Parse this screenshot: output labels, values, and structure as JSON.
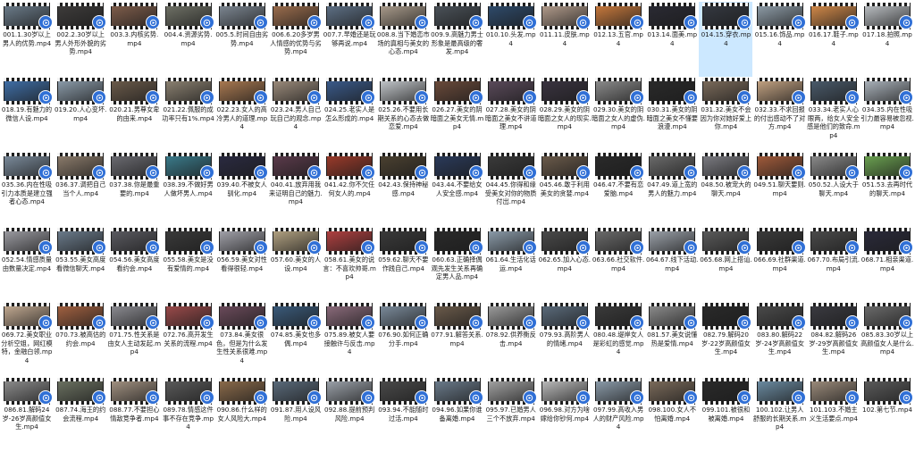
{
  "accent_color": "#2f6fd6",
  "selected_index": 13,
  "file_icon": "video-file-icon",
  "files": [
    {
      "name": "001.1.30岁以上男人的优势.mp4",
      "tint": "#6a7a88"
    },
    {
      "name": "002.2.30岁以上男人外形外貌的劣势.mp4",
      "tint": "#3d3b3a"
    },
    {
      "name": "003.3.内核劣势.mp4",
      "tint": "#7d5c4a"
    },
    {
      "name": "004.4.资源劣势.mp4",
      "tint": "#6e7065"
    },
    {
      "name": "005.5.时间自由劣势.mp4",
      "tint": "#7b8590"
    },
    {
      "name": "006.6.20多岁男人情感的优势与劣势.mp4",
      "tint": "#9a6c4c"
    },
    {
      "name": "007.7.早婚还是玩够再说.mp4",
      "tint": "#5d6f84"
    },
    {
      "name": "008.8.当下婚恋市场的真相与美女的心态.mp4",
      "tint": "#a89a8a"
    },
    {
      "name": "009.9.高魅力男士形象是最高级的奢发.mp4",
      "tint": "#4a5158"
    },
    {
      "name": "010.10.头发.mp4",
      "tint": "#2e4a6a"
    },
    {
      "name": "011.11.皮肤.mp4",
      "tint": "#b09a8a"
    },
    {
      "name": "012.13.五官.mp4",
      "tint": "#c6783c"
    },
    {
      "name": "013.14.面美.mp4",
      "tint": "#2a2a33"
    },
    {
      "name": "014.15.穿衣.mp4",
      "tint": "#343840"
    },
    {
      "name": "015.16.饰品.mp4",
      "tint": "#8c9aa5"
    },
    {
      "name": "016.17.鞋子.mp4",
      "tint": "#d08848"
    },
    {
      "name": "017.18.拍照.mp4",
      "tint": "#b8bcc0"
    },
    {
      "name": "018.19.有魅力的微信人设.mp4",
      "tint": "#3f6ea6"
    },
    {
      "name": "019.20.人心变坏.mp4",
      "tint": "#8a9aa8"
    },
    {
      "name": "020.21.男尊女卑的由来.mp4",
      "tint": "#6a5a4a"
    },
    {
      "name": "021.22.佩服的成功率只有1%.mp4",
      "tint": "#8a8070"
    },
    {
      "name": "022.23.女人的高冷男人的道理.mp4",
      "tint": "#a87850"
    },
    {
      "name": "023.24.男人自己玩自己的观念.mp4",
      "tint": "#9a8a7a"
    },
    {
      "name": "024.25.老实人是怎么形成的.mp4",
      "tint": "#3a5a8a"
    },
    {
      "name": "025.26.不要用长期关系的心态去做恋爱.mp4",
      "tint": "#c0c4c8"
    },
    {
      "name": "026.27.美女的阴暗面之美女无情.mp4",
      "tint": "#6a4a3a"
    },
    {
      "name": "027.28.美女的阴暗面之美女不讲道理.mp4",
      "tint": "#5a4a5a"
    },
    {
      "name": "028.29.美女的阴暗面之女人的现实.mp4",
      "tint": "#3a3440"
    },
    {
      "name": "029.30.美女的阴暗面之女人的虚伪.mp4",
      "tint": "#8a8a8a"
    },
    {
      "name": "030.31.美女的阴暗面之美女不懂要浪漫.mp4",
      "tint": "#2a2a2a"
    },
    {
      "name": "031.32.美女不会因为你对她好爱上你.mp4",
      "tint": "#7a6a5a"
    },
    {
      "name": "032.33.不求回报的付出感动不了对方.mp4",
      "tint": "#c0a080"
    },
    {
      "name": "033.34.老实人心眼两，给女人安全感是他们的致命.mp4",
      "tint": "#4a5a6a"
    },
    {
      "name": "034.35.内在性吸引力最容易被忽视.mp4",
      "tint": "#a8b0b8"
    },
    {
      "name": "035.36.内在性吸引力本质是建立强者心态.mp4",
      "tint": "#7a8a9a"
    },
    {
      "name": "036.37.调把自己当个人.mp4",
      "tint": "#8a7a6a"
    },
    {
      "name": "037.38.你是最重要的.mp4",
      "tint": "#6a6a70"
    },
    {
      "name": "038.39.不做好男人做坏男人.mp4",
      "tint": "#3a7a8a"
    },
    {
      "name": "039.40.不被女人驯化.mp4",
      "tint": "#2a2a40"
    },
    {
      "name": "040.41.放弃用我来证明自己的魅力.mp4",
      "tint": "#5a3a4a"
    },
    {
      "name": "041.42.你不欠任何女人的.mp4",
      "tint": "#9a3a2a"
    },
    {
      "name": "042.43.保持神秘感.mp4",
      "tint": "#4a4030"
    },
    {
      "name": "043.44.不要给女人安全感.mp4",
      "tint": "#2a3a5a"
    },
    {
      "name": "044.45.你得和缘受美女对你的物质付出.mp4",
      "tint": "#3a3a3a"
    },
    {
      "name": "045.46.敢于利用美女的贪婪.mp4",
      "tint": "#6a5a4a"
    },
    {
      "name": "046.47.不要有恋爱脑.mp4",
      "tint": "#2a2a2a"
    },
    {
      "name": "047.49.道上宽的男人的魅力.mp4",
      "tint": "#6a6a6a"
    },
    {
      "name": "048.50.被宠大的聊天.mp4",
      "tint": "#7a7a80"
    },
    {
      "name": "049.51.聊天要则.mp4",
      "tint": "#a05a3a"
    },
    {
      "name": "050.52.人设大于聊天.mp4",
      "tint": "#8a8a8a"
    },
    {
      "name": "051.53.去再时代的聊天.mp4",
      "tint": "#6aa050"
    },
    {
      "name": "052.54.情感质量由数量决定.mp4",
      "tint": "#9a9aa0"
    },
    {
      "name": "053.55.美女高度看微信聊天.mp4",
      "tint": "#6a7a8a"
    },
    {
      "name": "054.56.美女高度看约会.mp4",
      "tint": "#5a5a60"
    },
    {
      "name": "055.58.美女是没有爱情的.mp4",
      "tint": "#3a3a3a"
    },
    {
      "name": "056.59.美女对性看得很轻.mp4",
      "tint": "#a0a0a8"
    },
    {
      "name": "057.60.美女的人设.mp4",
      "tint": "#b0a080"
    },
    {
      "name": "058.61.美女的说言：不喜欢帅哥.mp4",
      "tint": "#b04040"
    },
    {
      "name": "059.62.聊天不要作践自己.mp4",
      "tint": "#3a3a3a"
    },
    {
      "name": "060.63.正确择偶观先发生关系再确定男人品.mp4",
      "tint": "#2a2a2a"
    },
    {
      "name": "061.64.生活化话运.mp4",
      "tint": "#8a9aa8"
    },
    {
      "name": "062.65.加入心态.mp4",
      "tint": "#4a4a4a"
    },
    {
      "name": "063.66.社交软件.mp4",
      "tint": "#6a6a6a"
    },
    {
      "name": "064.67.线下活动.mp4",
      "tint": "#9aa0a8"
    },
    {
      "name": "065.68.网上搭讪.mp4",
      "tint": "#5a5a5a"
    },
    {
      "name": "066.69.社群渠道.mp4",
      "tint": "#3a3a3a"
    },
    {
      "name": "067.70.布局引流.mp4",
      "tint": "#4a4a4a"
    },
    {
      "name": "068.71.相亲渠道.mp4",
      "tint": "#2a2a3a"
    },
    {
      "name": "069.72.美女职业分析空姐，网红模特，金融白领.mp4",
      "tint": "#c0a890"
    },
    {
      "name": "070.73.被高估的约会.mp4",
      "tint": "#a06040"
    },
    {
      "name": "071.75.性关系是由女人主动发起.mp4",
      "tint": "#8a8a90"
    },
    {
      "name": "072.76.高开发生关系的流程.mp4",
      "tint": "#9a4a4a"
    },
    {
      "name": "073.84.美女很色，但是为什么发生性关系很难.mp4",
      "tint": "#6a4a5a"
    },
    {
      "name": "074.85.美女也多偶.mp4",
      "tint": "#3a5a7a"
    },
    {
      "name": "075.89.被女人要接触许与反击.mp4",
      "tint": "#8a6a7a"
    },
    {
      "name": "076.90.如何正确分手.mp4",
      "tint": "#7a8a9a"
    },
    {
      "name": "077.91.解答关系.mp4",
      "tint": "#6a5a4a"
    },
    {
      "name": "078.92.供养衡反击.mp4",
      "tint": "#9a9a9a"
    },
    {
      "name": "079.93.高阶男人的情绪.mp4",
      "tint": "#5a6a7a"
    },
    {
      "name": "080.48.堤岸女人是彩虹的感觉.mp4",
      "tint": "#3a3a3a"
    },
    {
      "name": "081.57.美女说懂热是爱情.mp4",
      "tint": "#8a8a8a"
    },
    {
      "name": "082.79.解码20岁-22岁高颜值女生.mp4",
      "tint": "#2a2a2a"
    },
    {
      "name": "083.80.解码22岁-24岁高颜值女生.mp4",
      "tint": "#4a4a4a"
    },
    {
      "name": "084.82.解码26岁-29岁高颜值女生.mp4",
      "tint": "#3a3a40"
    },
    {
      "name": "085.83.30岁以上高颜值女人是什么.mp4",
      "tint": "#6a6a6a"
    },
    {
      "name": "086.81.解码24岁-26岁高颜值女生.mp4",
      "tint": "#8a8a8a"
    },
    {
      "name": "087.74.海王的约会流程.mp4",
      "tint": "#6a7060"
    },
    {
      "name": "088.77.不要担心情敌竞争者.mp4",
      "tint": "#a09080"
    },
    {
      "name": "089.78.情感这件事不存在竞争.mp4",
      "tint": "#5a5a5a"
    },
    {
      "name": "090.86.什么样的女人风险大.mp4",
      "tint": "#8a6a4a"
    },
    {
      "name": "091.87.用人设风险.mp4",
      "tint": "#5a6a7a"
    },
    {
      "name": "092.88.提前预判风险.mp4",
      "tint": "#9aa0a8"
    },
    {
      "name": "093.94.不能随时过活.mp4",
      "tint": "#4a4a4a"
    },
    {
      "name": "094.96.如果你谁备离婚.mp4",
      "tint": "#6a7a8a"
    },
    {
      "name": "095.97.已婚男人三个不放弃.mp4",
      "tint": "#a0a0a0"
    },
    {
      "name": "096.98.对方为啥嫁给你钞何.mp4",
      "tint": "#b8b8b8"
    },
    {
      "name": "097.99.高收入男人的财产风险.mp4",
      "tint": "#8a9aa8"
    },
    {
      "name": "098.100.女人不怕离婚.mp4",
      "tint": "#7a6a5a"
    },
    {
      "name": "099.101.被很和被离婚.mp4",
      "tint": "#2a2a2a"
    },
    {
      "name": "100.102.让男人舒服的长期关系.mp4",
      "tint": "#6a8aa0"
    },
    {
      "name": "101.103.不婚主义生活要点.mp4",
      "tint": "#9a8a7a"
    },
    {
      "name": "102.第七节.mp4",
      "tint": "#5a5a5a"
    }
  ]
}
